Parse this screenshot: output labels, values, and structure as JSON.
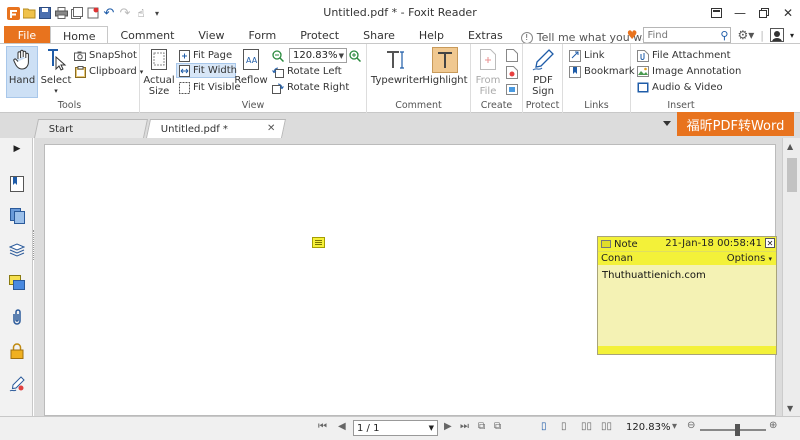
{
  "window": {
    "title": "Untitled.pdf * - Foxit Reader",
    "qat_icons": [
      "app-logo-icon",
      "open-icon",
      "save-icon",
      "print-icon",
      "new-window-icon",
      "quick-tool-icon",
      "undo-icon",
      "redo-icon",
      "hand-tool-icon",
      "customize-icon"
    ]
  },
  "ribbon_tabs": [
    "File",
    "Home",
    "Comment",
    "View",
    "Form",
    "Protect",
    "Share",
    "Help",
    "Extras"
  ],
  "active_tab": "Home",
  "tellme_placeholder": "Tell me what you wa",
  "find_placeholder": "Find",
  "groups": {
    "tools": {
      "label": "Tools",
      "hand": "Hand",
      "select": "Select",
      "snapshot": "SnapShot",
      "clipboard": "Clipboard"
    },
    "view": {
      "label": "View",
      "actual_size_1": "Actual",
      "actual_size_2": "Size",
      "fit_page": "Fit Page",
      "fit_width": "Fit Width",
      "fit_visible": "Fit Visible",
      "reflow": "Reflow",
      "zoom_value": "120.83%",
      "rotate_left": "Rotate Left",
      "rotate_right": "Rotate Right"
    },
    "comment": {
      "label": "Comment",
      "typewriter": "Typewriter",
      "highlight": "Highlight"
    },
    "create": {
      "label": "Create",
      "from_file_1": "From",
      "from_file_2": "File"
    },
    "protect": {
      "label": "Protect",
      "pdf_sign_1": "PDF",
      "pdf_sign_2": "Sign"
    },
    "links": {
      "label": "Links",
      "link": "Link",
      "bookmark": "Bookmark"
    },
    "insert": {
      "label": "Insert",
      "file_attachment": "File Attachment",
      "image_annotation": "Image Annotation",
      "audio_video": "Audio & Video"
    }
  },
  "doc_tabs": [
    {
      "label": "Start",
      "active": false
    },
    {
      "label": "Untitled.pdf *",
      "active": true
    }
  ],
  "promo_banner": "福昕PDF转Word",
  "note": {
    "type": "Note",
    "date": "21-Jan-18 00:58:41",
    "author": "Conan",
    "options": "Options",
    "content": "Thuthuattienich.com"
  },
  "status": {
    "page_value": "1 / 1",
    "zoom": "120.83%"
  },
  "colors": {
    "accent": "#e8731e",
    "note_yellow": "#f3f139",
    "note_body": "#f4f2b4",
    "link_blue": "#1f5ca8"
  }
}
